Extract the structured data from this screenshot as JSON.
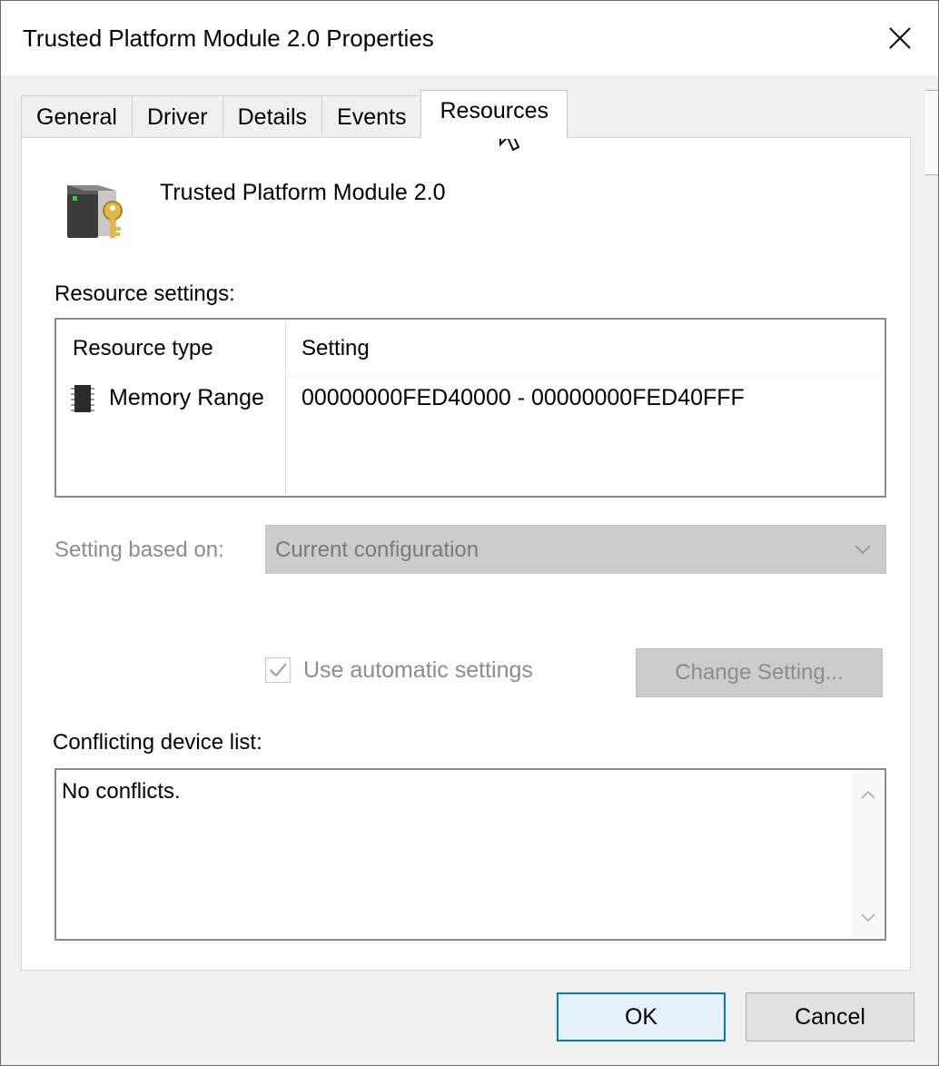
{
  "window": {
    "title": "Trusted Platform Module 2.0 Properties",
    "close_icon": "close-icon"
  },
  "tabs": [
    {
      "label": "General"
    },
    {
      "label": "Driver"
    },
    {
      "label": "Details"
    },
    {
      "label": "Events"
    },
    {
      "label": "Resources",
      "active": true
    }
  ],
  "device": {
    "name": "Trusted Platform Module 2.0",
    "icon": "tpm-device-icon"
  },
  "resource_settings": {
    "label": "Resource settings:",
    "columns": [
      "Resource type",
      "Setting"
    ],
    "rows": [
      {
        "type": "Memory Range",
        "setting": "00000000FED40000 - 00000000FED40FFF",
        "icon": "memory-chip-icon"
      }
    ]
  },
  "setting_based_on": {
    "label": "Setting based on:",
    "value": "Current configuration"
  },
  "automatic": {
    "label": "Use automatic settings",
    "checked": true
  },
  "change_setting": {
    "label": "Change Setting..."
  },
  "conflicts": {
    "label": "Conflicting device list:",
    "text": "No conflicts."
  },
  "buttons": {
    "ok": "OK",
    "cancel": "Cancel"
  },
  "colors": {
    "accent": "#0078d7",
    "disabled_text": "#8c8c8c",
    "disabled_bg": "#cccccc"
  }
}
